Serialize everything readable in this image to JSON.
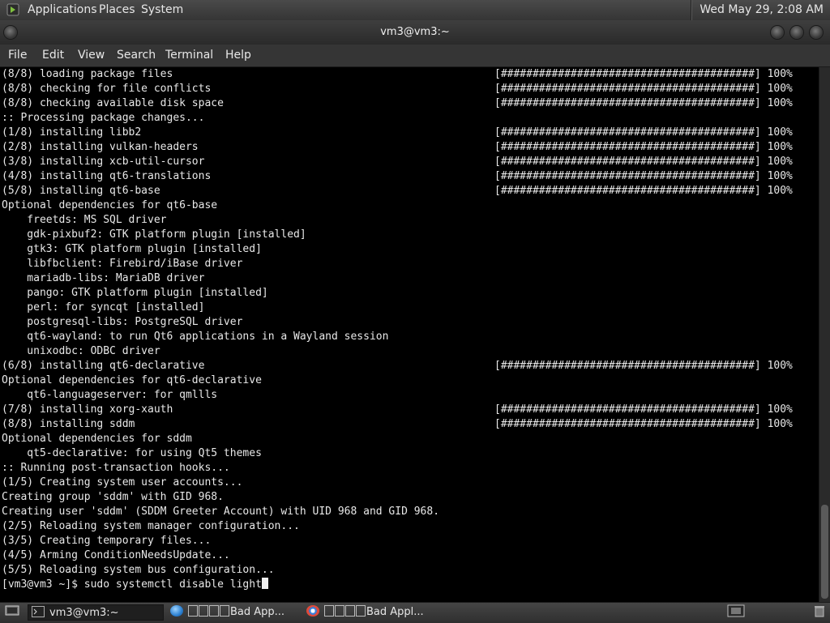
{
  "top_panel": {
    "menus": [
      "Applications",
      "Places",
      "System"
    ],
    "clock": "Wed May 29,  2:08 AM"
  },
  "window": {
    "title": "vm3@vm3:~",
    "menus": [
      "File",
      "Edit",
      "View",
      "Search",
      "Terminal",
      "Help"
    ]
  },
  "terminal": {
    "progress_bar": "[########################################]",
    "percent": "100%",
    "lines": [
      {
        "text": "(8/8) loading package files",
        "progress": true
      },
      {
        "text": "(8/8) checking for file conflicts",
        "progress": true
      },
      {
        "text": "(8/8) checking available disk space",
        "progress": true
      },
      {
        "text": ":: Processing package changes...",
        "progress": false
      },
      {
        "text": "(1/8) installing libb2",
        "progress": true
      },
      {
        "text": "(2/8) installing vulkan-headers",
        "progress": true
      },
      {
        "text": "(3/8) installing xcb-util-cursor",
        "progress": true
      },
      {
        "text": "(4/8) installing qt6-translations",
        "progress": true
      },
      {
        "text": "(5/8) installing qt6-base",
        "progress": true
      },
      {
        "text": "Optional dependencies for qt6-base",
        "progress": false
      },
      {
        "text": "    freetds: MS SQL driver",
        "progress": false
      },
      {
        "text": "    gdk-pixbuf2: GTK platform plugin [installed]",
        "progress": false
      },
      {
        "text": "    gtk3: GTK platform plugin [installed]",
        "progress": false
      },
      {
        "text": "    libfbclient: Firebird/iBase driver",
        "progress": false
      },
      {
        "text": "    mariadb-libs: MariaDB driver",
        "progress": false
      },
      {
        "text": "    pango: GTK platform plugin [installed]",
        "progress": false
      },
      {
        "text": "    perl: for syncqt [installed]",
        "progress": false
      },
      {
        "text": "    postgresql-libs: PostgreSQL driver",
        "progress": false
      },
      {
        "text": "    qt6-wayland: to run Qt6 applications in a Wayland session",
        "progress": false
      },
      {
        "text": "    unixodbc: ODBC driver",
        "progress": false
      },
      {
        "text": "(6/8) installing qt6-declarative",
        "progress": true
      },
      {
        "text": "Optional dependencies for qt6-declarative",
        "progress": false
      },
      {
        "text": "    qt6-languageserver: for qmllls",
        "progress": false
      },
      {
        "text": "(7/8) installing xorg-xauth",
        "progress": true
      },
      {
        "text": "(8/8) installing sddm",
        "progress": true
      },
      {
        "text": "Optional dependencies for sddm",
        "progress": false
      },
      {
        "text": "    qt5-declarative: for using Qt5 themes",
        "progress": false
      },
      {
        "text": ":: Running post-transaction hooks...",
        "progress": false
      },
      {
        "text": "(1/5) Creating system user accounts...",
        "progress": false
      },
      {
        "text": "Creating group 'sddm' with GID 968.",
        "progress": false
      },
      {
        "text": "Creating user 'sddm' (SDDM Greeter Account) with UID 968 and GID 968.",
        "progress": false
      },
      {
        "text": "(2/5) Reloading system manager configuration...",
        "progress": false
      },
      {
        "text": "(3/5) Creating temporary files...",
        "progress": false
      },
      {
        "text": "(4/5) Arming ConditionNeedsUpdate...",
        "progress": false
      },
      {
        "text": "(5/5) Reloading system bus configuration...",
        "progress": false
      }
    ],
    "prompt": "[vm3@vm3 ~]$ sudo systemctl disable light"
  },
  "taskbar": {
    "tasks": [
      {
        "label": "vm3@vm3:~",
        "icon": "terminal-icon"
      },
      {
        "label": "Bad App...",
        "icon": "globe-icon"
      },
      {
        "label": "Bad Appl...",
        "icon": "chrome-icon"
      }
    ]
  },
  "colors": {
    "terminal_bg": "#000000",
    "terminal_fg": "#e8e8e8",
    "panel_bg": "#3a3a3a"
  }
}
